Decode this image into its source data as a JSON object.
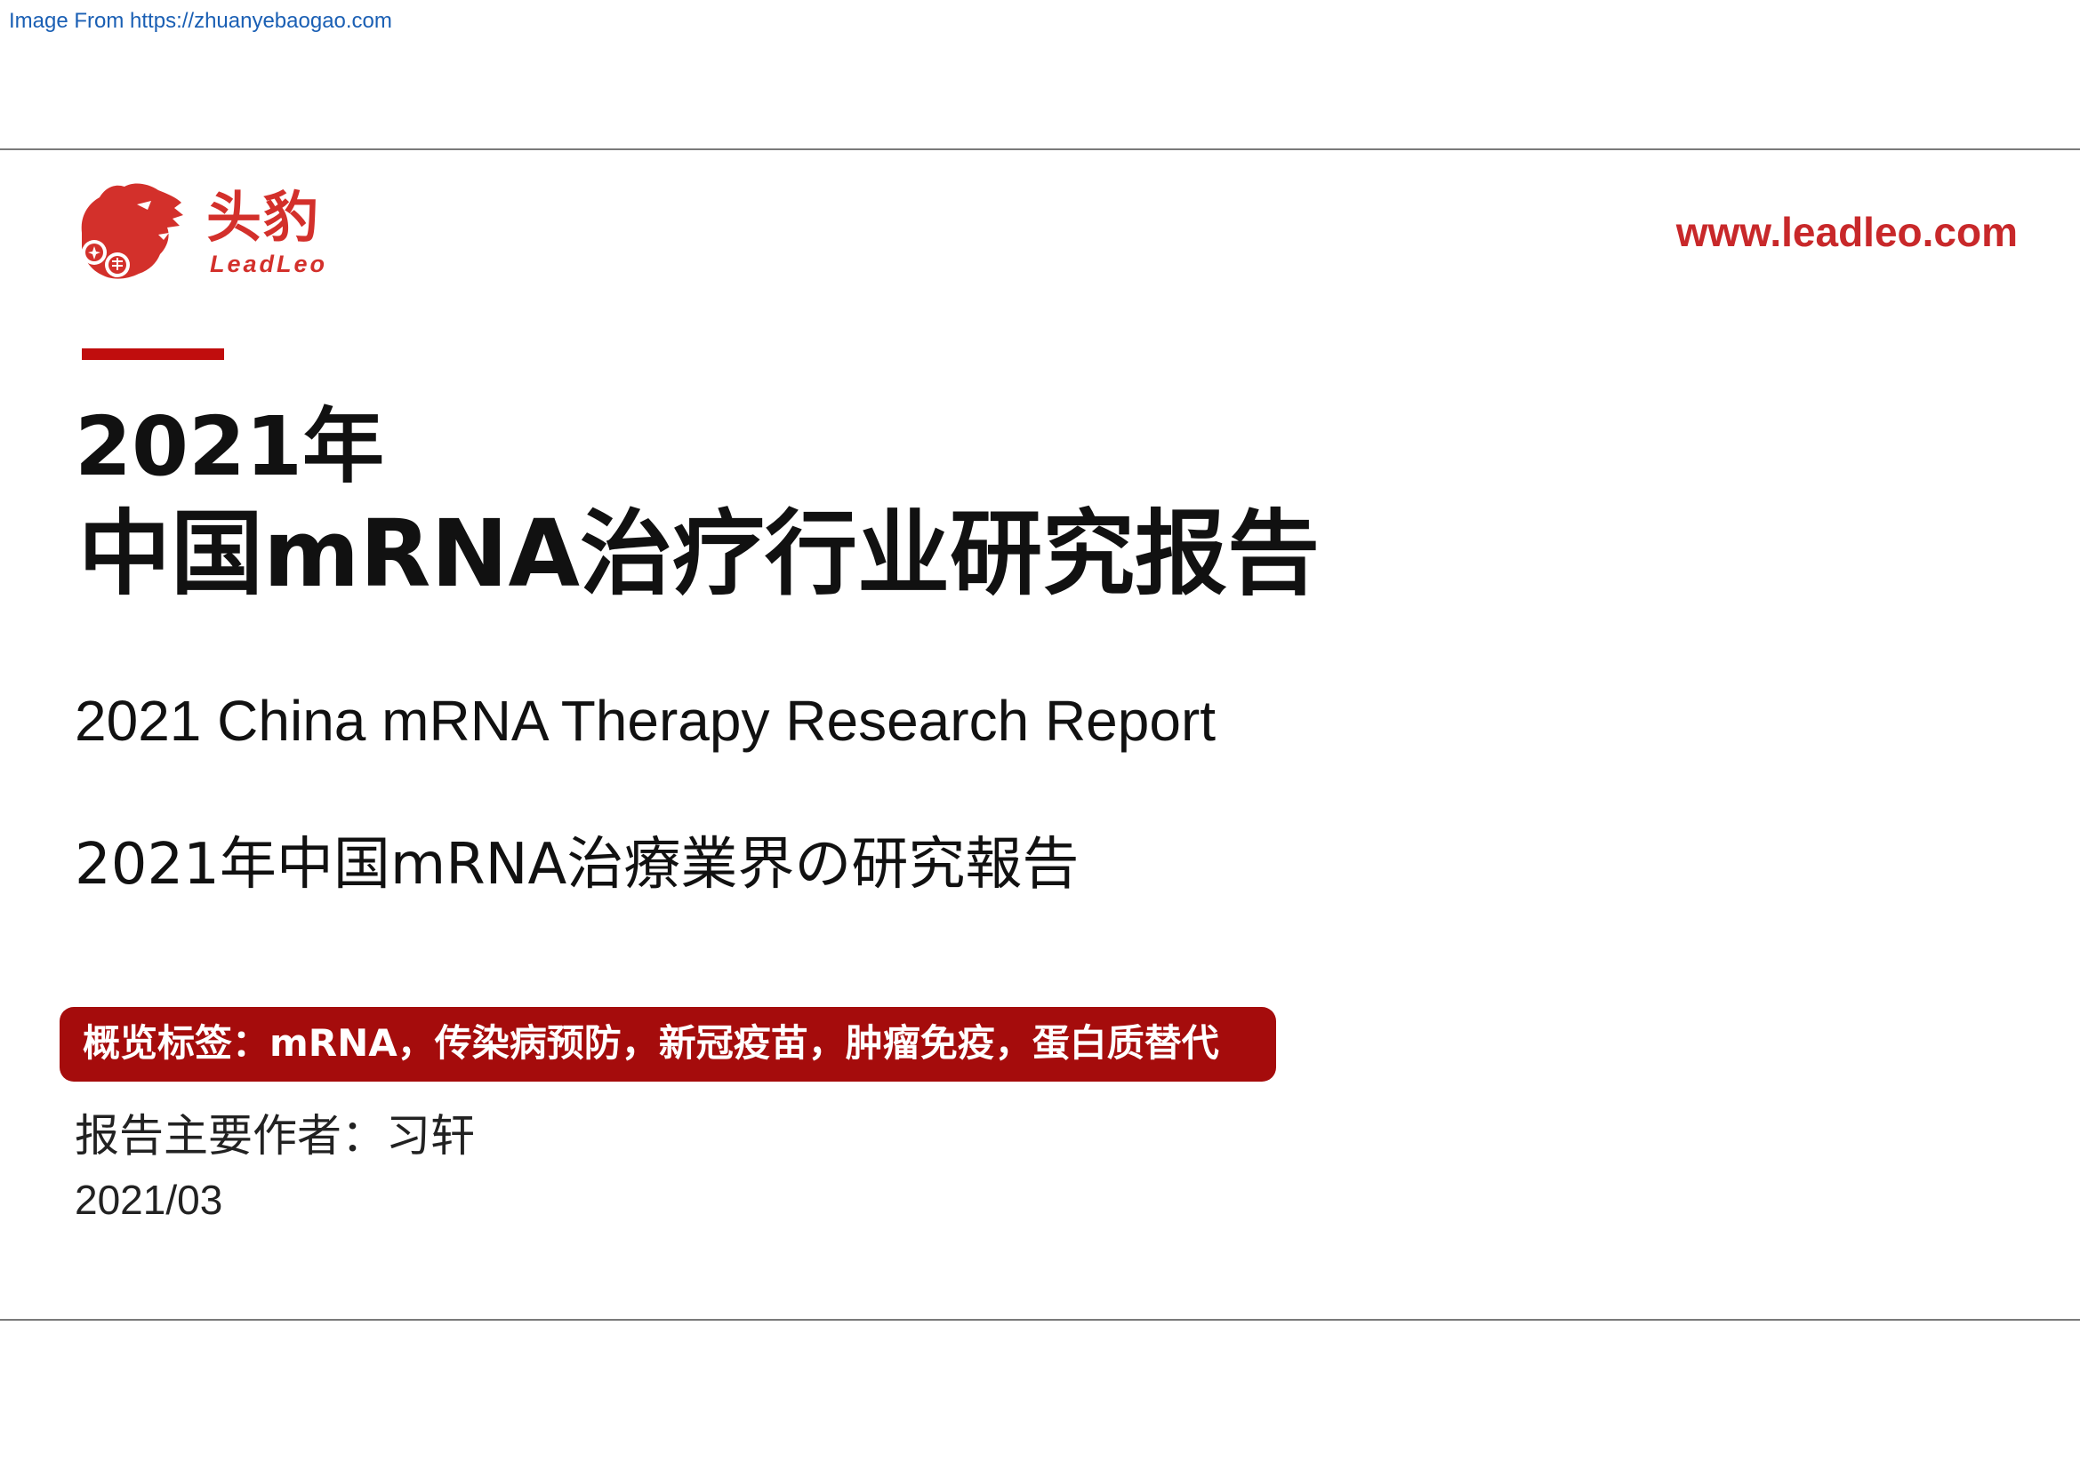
{
  "source_link": "Image From https://zhuanyebaogao.com",
  "brand": {
    "name_cn": "头豹",
    "name_en": "LeadLeo",
    "website": "www.leadleo.com",
    "color": "#d3302b"
  },
  "accent_color": "#c00d0d",
  "title": {
    "year": "2021年",
    "main": "中国mRNA治疗行业研究报告",
    "english": "2021 China mRNA Therapy Research Report",
    "japanese": "2021年中国mRNA治療業界の研究報告"
  },
  "tags": {
    "text": "概览标签：mRNA，传染病预防，新冠疫苗，肿瘤免疫，蛋白质替代",
    "background": "#a50c0c"
  },
  "author": "报告主要作者：习轩",
  "date": "2021/03"
}
